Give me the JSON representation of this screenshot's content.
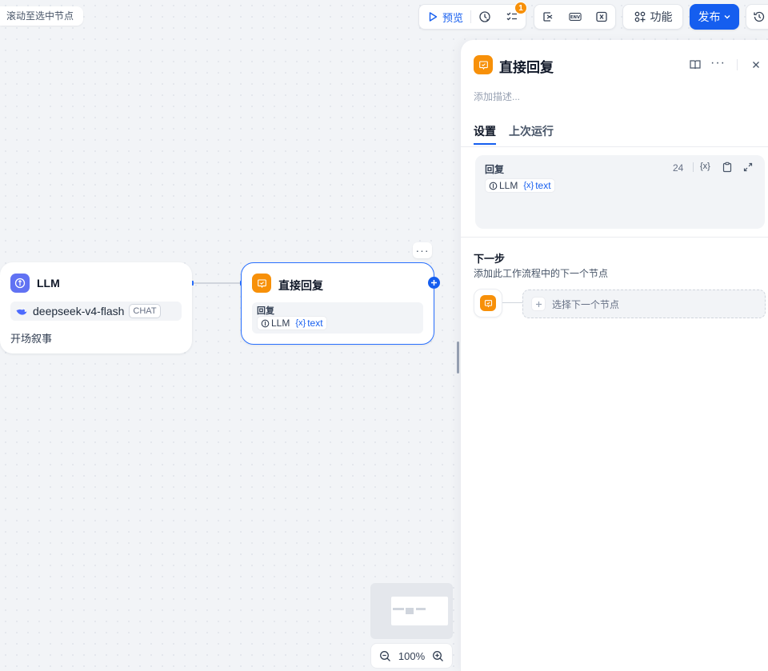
{
  "canvas": {
    "scroll_to_selected": "滚动至选中节点",
    "zoom_level": "100%"
  },
  "toolbar": {
    "preview_label": "预览",
    "checklist_badge": "1",
    "env_label": "ENV",
    "features_label": "功能",
    "publish_label": "发布"
  },
  "nodes": {
    "llm": {
      "title": "LLM",
      "model_name": "deepseek-v4-flash",
      "model_mode": "CHAT",
      "description": "开场叙事"
    },
    "answer": {
      "title": "直接回复",
      "field_label": "回复",
      "var_source": "LLM",
      "var_name": "text"
    }
  },
  "panel": {
    "title": "直接回复",
    "description_placeholder": "添加描述...",
    "tabs": [
      "设置",
      "上次运行"
    ],
    "active_tab": 0,
    "reply": {
      "label": "回复",
      "count": "24",
      "var_source": "LLM",
      "var_name": "text"
    },
    "next_step": {
      "title": "下一步",
      "subtitle": "添加此工作流程中的下一个节点",
      "select_label": "选择下一个节点"
    }
  },
  "colors": {
    "accent": "#155eef",
    "answer_icon_bg": "#f79009",
    "llm_icon_bg": "#6172f3"
  }
}
